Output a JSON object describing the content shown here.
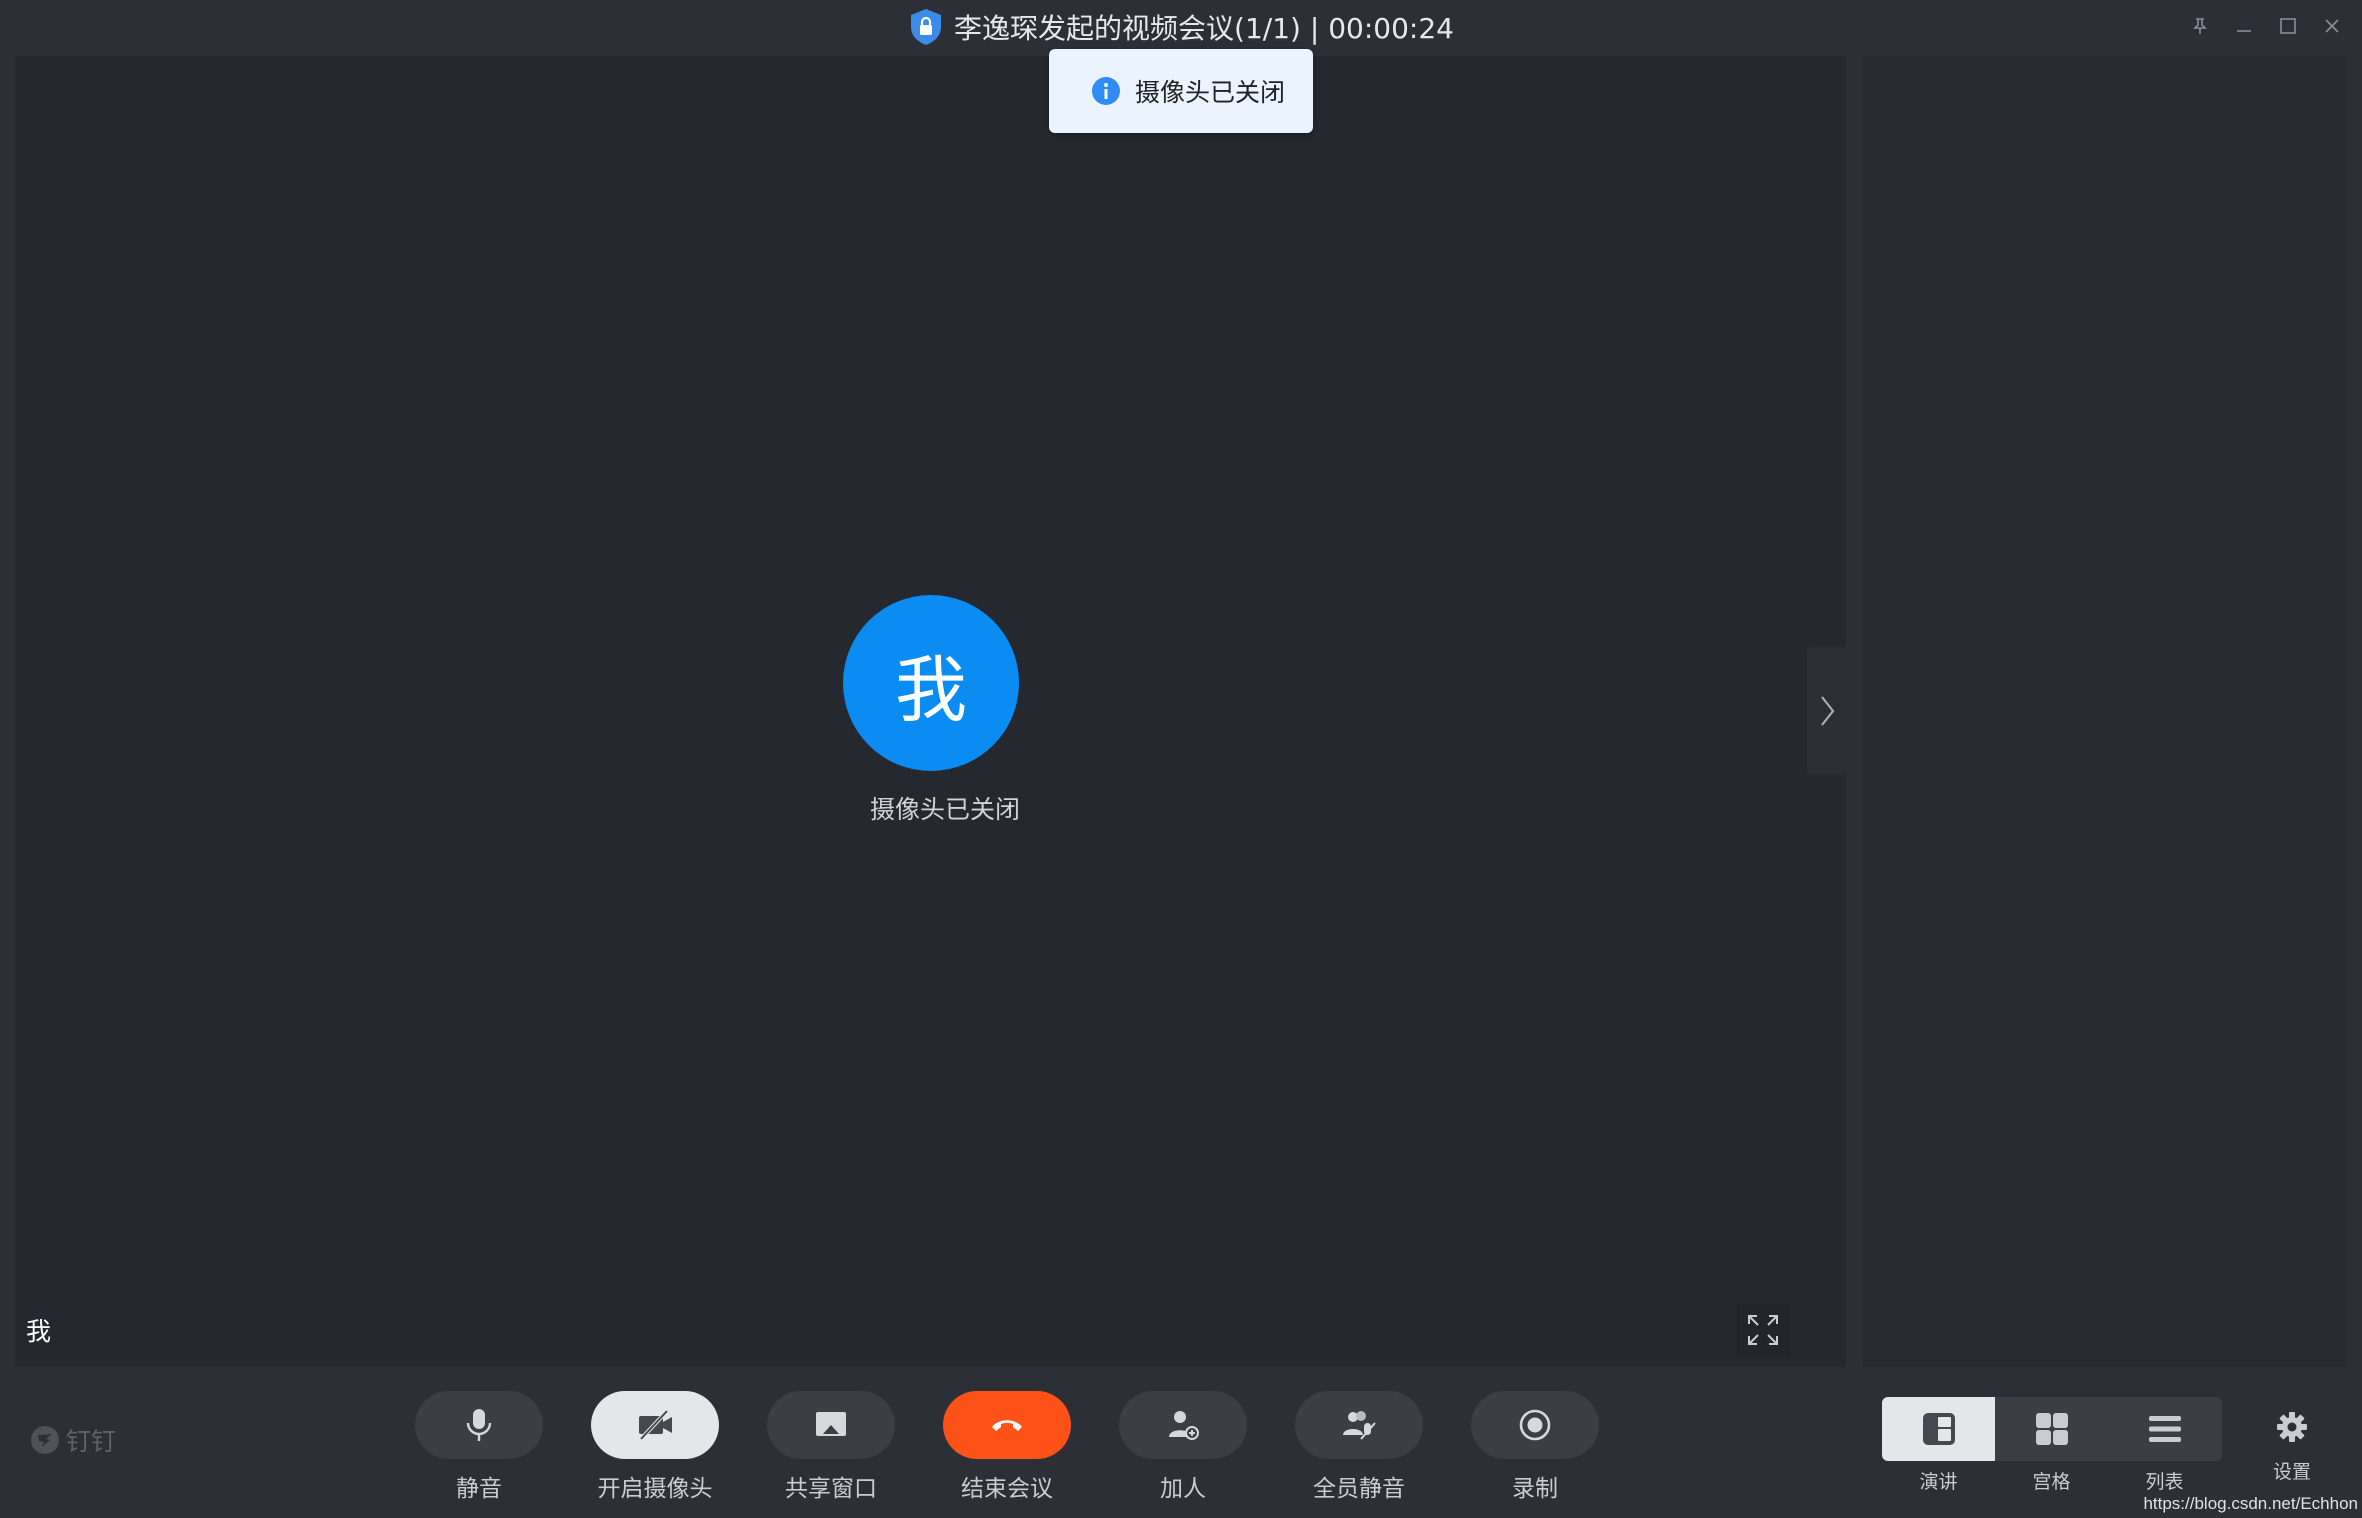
{
  "titlebar": {
    "title": "李逸琛发起的视频会议(1/1) | 00:00:24",
    "pin_icon": "pin-icon",
    "minimize_icon": "minimize-icon",
    "maximize_icon": "maximize-icon",
    "close_icon": "close-icon"
  },
  "toast": {
    "message": "摄像头已关闭",
    "icon": "info-icon"
  },
  "stage": {
    "avatar_text": "我",
    "camera_status": "摄像头已关闭",
    "self_name": "我"
  },
  "toolbar": {
    "brand": "钉钉",
    "controls": [
      {
        "label": "静音",
        "icon": "microphone-icon"
      },
      {
        "label": "开启摄像头",
        "icon": "camera-off-icon"
      },
      {
        "label": "共享窗口",
        "icon": "share-screen-icon"
      },
      {
        "label": "结束会议",
        "icon": "hang-up-icon"
      },
      {
        "label": "加人",
        "icon": "add-person-icon"
      },
      {
        "label": "全员静音",
        "icon": "mute-all-icon"
      },
      {
        "label": "录制",
        "icon": "record-icon"
      }
    ],
    "layouts": [
      {
        "label": "演讲",
        "icon": "speaker-layout-icon",
        "active": true
      },
      {
        "label": "宫格",
        "icon": "grid-layout-icon",
        "active": false
      },
      {
        "label": "列表",
        "icon": "list-layout-icon",
        "active": false
      }
    ],
    "settings_label": "设置"
  },
  "colors": {
    "accent_blue": "#0a8cf2",
    "end_call_red": "#ff5219",
    "background": "#2c2f35",
    "stage": "#25282e"
  },
  "watermark": "https://blog.csdn.net/Echhon"
}
